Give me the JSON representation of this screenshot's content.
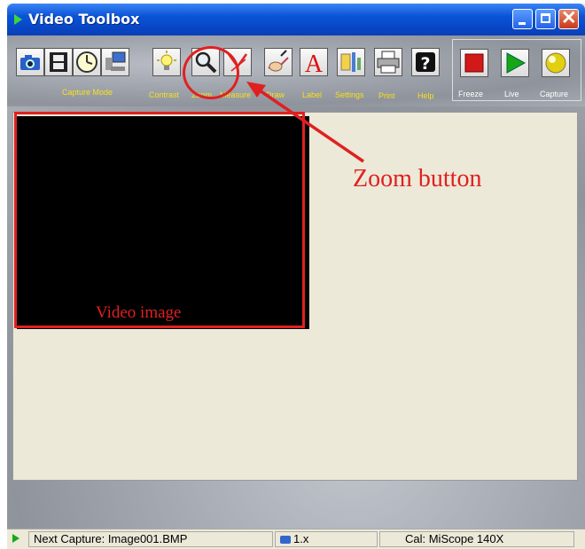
{
  "window": {
    "title": "Video Toolbox"
  },
  "toolbar": {
    "capture_mode_label": "Capture Mode",
    "contrast_label": "Contrast",
    "zoom_label": "Zoom",
    "measure_label": "Measure",
    "draw_label": "Draw",
    "label_label": "Label",
    "settings_label": "Settings",
    "print_label": "Print",
    "help_label": "Help",
    "freeze_label": "Freeze",
    "live_label": "Live",
    "capture_label": "Capture"
  },
  "status": {
    "next_capture": "Next Capture: Image001.BMP",
    "zoom_level": "1.x",
    "calibration": "Cal: MiScope 140X"
  },
  "annotations": {
    "zoom_button": "Zoom button",
    "video_image": "Video image"
  },
  "colors": {
    "annotation": "#e02020",
    "label_yellow": "#f7e11a",
    "title_bar": "#0a53d6"
  }
}
